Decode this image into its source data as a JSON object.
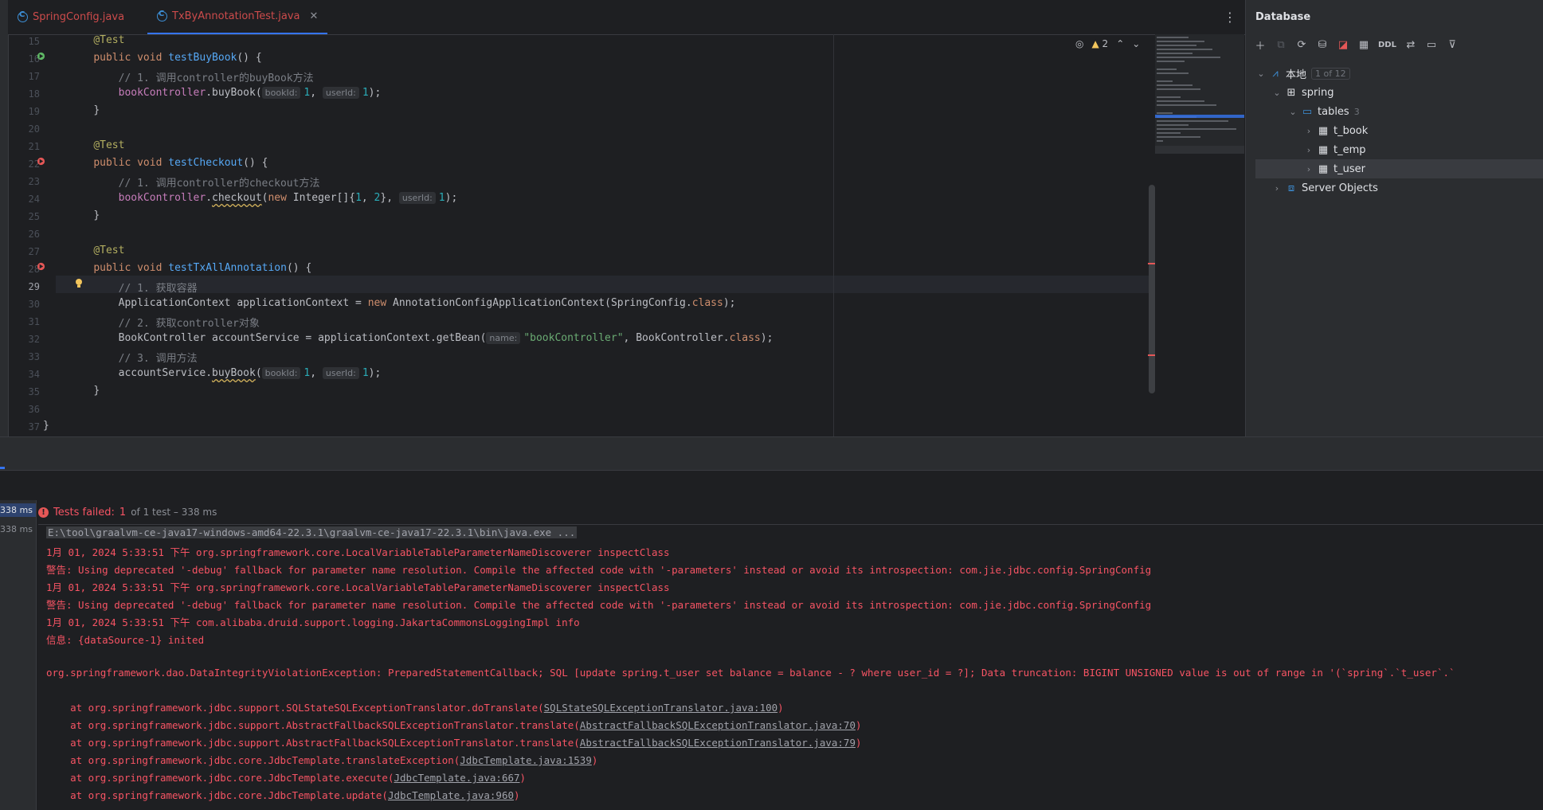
{
  "tabs": [
    {
      "label": "SpringConfig.java",
      "active": false
    },
    {
      "label": "TxByAnnotationTest.java",
      "active": true,
      "closable": true
    }
  ],
  "editor": {
    "current_line": "29",
    "line_numbers": [
      "15",
      "16",
      "17",
      "18",
      "19",
      "20",
      "21",
      "22",
      "23",
      "24",
      "25",
      "26",
      "27",
      "28",
      "29",
      "30",
      "31",
      "32",
      "33",
      "34",
      "35",
      "36",
      "37"
    ],
    "inspections": {
      "warning_count": "2"
    },
    "code": {
      "l15_ann": "@Test",
      "l16_kw1": "public",
      "l16_kw2": "void",
      "l16_fn": "testBuyBook",
      "l16_rest": "() {",
      "l17_cmt": "// 1. 调用controller的buyBook方法",
      "l18_field": "bookController",
      "l18_call": ".buyBook(",
      "l18_h1": "bookId:",
      "l18_v1": "1",
      "l18_sep": ", ",
      "l18_h2": "userId:",
      "l18_v2": "1",
      "l18_end": ");",
      "l19": "}",
      "l21_ann": "@Test",
      "l22_kw1": "public",
      "l22_kw2": "void",
      "l22_fn": "testCheckout",
      "l22_rest": "() {",
      "l23_cmt": "// 1. 调用controller的checkout方法",
      "l24_field": "bookController",
      "l24_dot": ".",
      "l24_call": "checkout",
      "l24_open": "(",
      "l24_new": "new",
      "l24_type": " Integer[]{",
      "l24_v1": "1",
      "l24_c": ", ",
      "l24_v2": "2",
      "l24_close": "}, ",
      "l24_h1": "userId:",
      "l24_v3": "1",
      "l24_end": ");",
      "l25": "}",
      "l27_ann": "@Test",
      "l28_kw1": "public",
      "l28_kw2": "void",
      "l28_fn": "testTxAllAnnotation",
      "l28_rest": "() {",
      "l29_cmt": "// 1. 获取容器",
      "l30_a": "ApplicationContext applicationContext = ",
      "l30_new": "new",
      "l30_b": " AnnotationConfigApplicationContext(SpringConfig.",
      "l30_cls": "class",
      "l30_end": ");",
      "l31_cmt": "// 2. 获取controller对象",
      "l32_a": "BookController accountService = applicationContext.getBean(",
      "l32_h1": "name:",
      "l32_str": "\"bookController\"",
      "l32_b": ", BookController.",
      "l32_cls": "class",
      "l32_end": ");",
      "l33_cmt": "// 3. 调用方法",
      "l34_a": "accountService.",
      "l34_call": "buyBook",
      "l34_open": "(",
      "l34_h1": "bookId:",
      "l34_v1": "1",
      "l34_sep": ", ",
      "l34_h2": "userId:",
      "l34_v2": "1",
      "l34_end": ");",
      "l35": "}",
      "l37": "}"
    }
  },
  "database": {
    "title": "Database",
    "toolbar": {
      "ddl_label": "DDL"
    },
    "tree": [
      {
        "label": "本地",
        "badge": "1 of 12"
      },
      {
        "label": "spring"
      },
      {
        "label": "tables",
        "badge": "3"
      },
      {
        "label": "t_book"
      },
      {
        "label": "t_emp"
      },
      {
        "label": "t_user",
        "selected": true
      },
      {
        "label": "Server Objects"
      }
    ]
  },
  "run": {
    "test_times": [
      "338 ms",
      "338 ms"
    ],
    "status_failed": "Tests failed:",
    "status_count": "1",
    "status_rest": "of 1 test – 338 ms",
    "console": [
      {
        "text": "E:\\tool\\graalvm-ce-java17-windows-amd64-22.3.1\\graalvm-ce-java17-22.3.1\\bin\\java.exe ..."
      },
      {
        "text": "1月 01, 2024 5:33:51 下午 org.springframework.core.LocalVariableTableParameterNameDiscoverer inspectClass"
      },
      {
        "text": "警告: Using deprecated '-debug' fallback for parameter name resolution. Compile the affected code with '-parameters' instead or avoid its introspection: com.jie.jdbc.config.SpringConfig"
      },
      {
        "text": "1月 01, 2024 5:33:51 下午 org.springframework.core.LocalVariableTableParameterNameDiscoverer inspectClass"
      },
      {
        "text": "警告: Using deprecated '-debug' fallback for parameter name resolution. Compile the affected code with '-parameters' instead or avoid its introspection: com.jie.jdbc.config.SpringConfig"
      },
      {
        "text": "1月 01, 2024 5:33:51 下午 com.alibaba.druid.support.logging.JakartaCommonsLoggingImpl info"
      },
      {
        "text": "信息: {dataSource-1} inited"
      },
      {
        "text": "org.springframework.dao.DataIntegrityViolationException: PreparedStatementCallback; SQL [update spring.t_user set balance = balance - ? where user_id = ?]; Data truncation: BIGINT UNSIGNED value is out of range in '(`spring`.`t_user`.`"
      },
      {
        "text": "    at org.springframework.jdbc.support.SQLStateSQLExceptionTranslator.doTranslate(",
        "link": "SQLStateSQLExceptionTranslator.java:100",
        "end": ")"
      },
      {
        "text": "    at org.springframework.jdbc.support.AbstractFallbackSQLExceptionTranslator.translate(",
        "link": "AbstractFallbackSQLExceptionTranslator.java:70",
        "end": ")"
      },
      {
        "text": "    at org.springframework.jdbc.support.AbstractFallbackSQLExceptionTranslator.translate(",
        "link": "AbstractFallbackSQLExceptionTranslator.java:79",
        "end": ")"
      },
      {
        "text": "    at org.springframework.jdbc.core.JdbcTemplate.translateException(",
        "link": "JdbcTemplate.java:1539",
        "end": ")"
      },
      {
        "text": "    at org.springframework.jdbc.core.JdbcTemplate.execute(",
        "link": "JdbcTemplate.java:667",
        "end": ")"
      },
      {
        "text": "    at org.springframework.jdbc.core.JdbcTemplate.update(",
        "link": "JdbcTemplate.java:960",
        "end": ")"
      }
    ]
  },
  "colors": {
    "accent": "#3574f0",
    "error": "#f75464",
    "keyword": "#cf8e6d",
    "annotation": "#b3ae60",
    "function": "#56a8f5",
    "comment": "#7a7e85",
    "number": "#2aacb8",
    "string": "#6aab73"
  }
}
